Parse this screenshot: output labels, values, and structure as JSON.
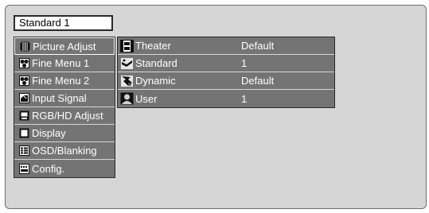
{
  "header": {
    "title": "Standard 1"
  },
  "sidebar": {
    "items": [
      {
        "label": "Picture Adjust",
        "icon": "picture-adjust-icon"
      },
      {
        "label": "Fine Menu 1",
        "icon": "fine-menu-icon"
      },
      {
        "label": "Fine Menu 2",
        "icon": "fine-menu-icon"
      },
      {
        "label": "Input Signal",
        "icon": "input-signal-icon"
      },
      {
        "label": "RGB/HD Adjust",
        "icon": "monitor-icon"
      },
      {
        "label": "Display",
        "icon": "display-icon"
      },
      {
        "label": "OSD/Blanking",
        "icon": "osd-icon"
      },
      {
        "label": "Config.",
        "icon": "config-icon"
      }
    ]
  },
  "modes": {
    "rows": [
      {
        "name": "Theater",
        "value": "Default",
        "icon": "film-icon"
      },
      {
        "name": "Standard",
        "value": "1",
        "icon": "standard-mode-icon"
      },
      {
        "name": "Dynamic",
        "value": "Default",
        "icon": "dynamic-mode-icon"
      },
      {
        "name": "User",
        "value": "1",
        "icon": "user-icon"
      }
    ]
  },
  "colors": {
    "frame_bg": "#d6d6d6",
    "menu_bg": "#747474",
    "text": "#ffffff"
  }
}
